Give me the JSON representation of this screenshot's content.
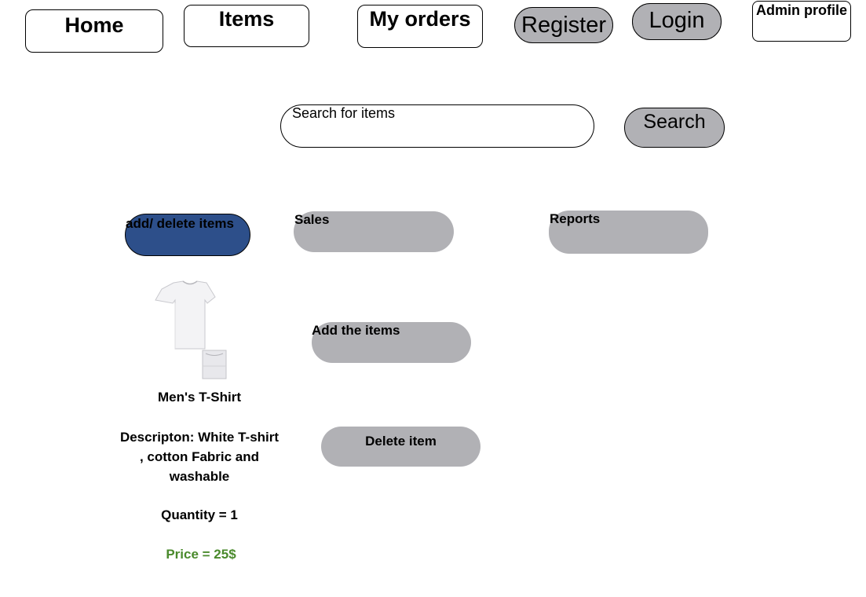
{
  "nav": {
    "home": "Home",
    "items": "Items",
    "my_orders": "My orders",
    "register": "Register",
    "login": "Login",
    "admin_profile": "Admin profile"
  },
  "search": {
    "placeholder": "Search for items",
    "button_label": "Search"
  },
  "admin_tabs": {
    "add_delete": "add/ delete items",
    "sales": "Sales",
    "reports": "Reports"
  },
  "actions": {
    "add_items": "Add the items",
    "delete_item": "Delete item"
  },
  "product": {
    "image_icon": "tshirt-image",
    "name": "Men's  T-Shirt",
    "description_line1": "Descripton: White T-shirt",
    "description_line2": ", cotton Fabric and",
    "description_line3": "washable",
    "quantity": "Quantity = 1",
    "price": "Price = 25$"
  },
  "colors": {
    "active_tab": "#2d4f8a",
    "pill_gray": "#b1b1b5",
    "price_green": "#4a8a2c"
  }
}
